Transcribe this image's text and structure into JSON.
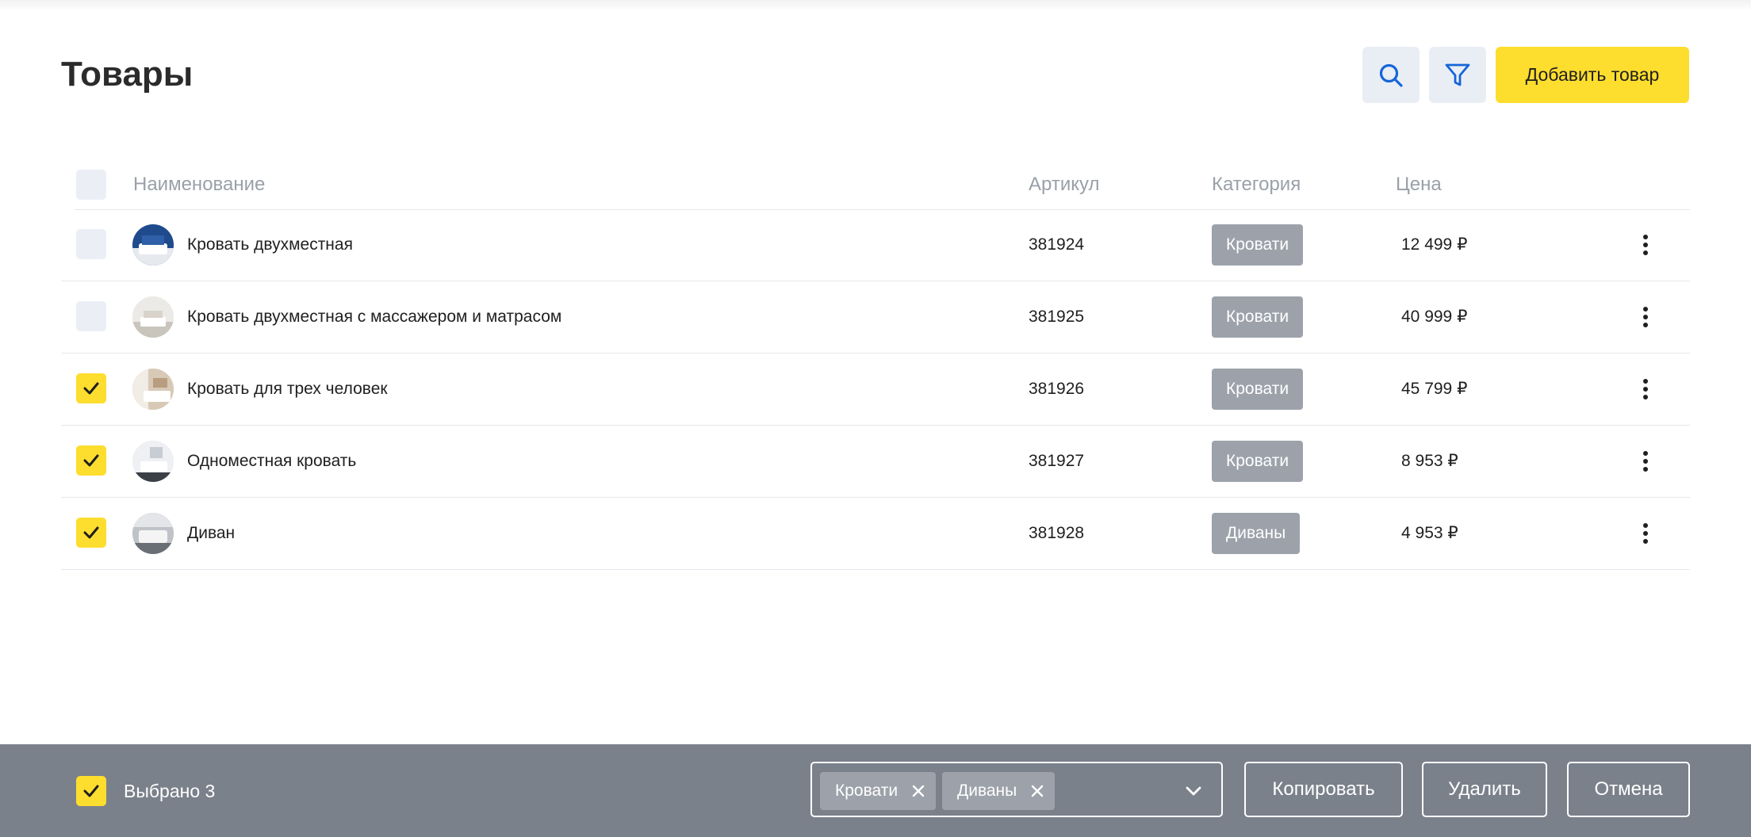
{
  "header": {
    "title": "Товары",
    "search_icon": "search-icon",
    "filter_icon": "filter-icon",
    "add_label": "Добавить товар"
  },
  "colors": {
    "accent": "#FDDD2E",
    "icon_blue": "#1565D8",
    "bar": "#7B818B",
    "badge": "#9DA2AA"
  },
  "table": {
    "columns": [
      "Наименование",
      "Артикул",
      "Категория",
      "Цена"
    ],
    "rows": [
      {
        "name": "Кровать двухместная",
        "sku": "381924",
        "category": "Кровати",
        "price": "12 499 ₽",
        "checked": false
      },
      {
        "name": "Кровать двухместная с массажером и матрасом",
        "sku": "381925",
        "category": "Кровати",
        "price": "40 999 ₽",
        "checked": false
      },
      {
        "name": "Кровать для трех человек",
        "sku": "381926",
        "category": "Кровати",
        "price": "45 799 ₽",
        "checked": true
      },
      {
        "name": "Одноместная кровать",
        "sku": "381927",
        "category": "Кровати",
        "price": "8 953 ₽",
        "checked": true
      },
      {
        "name": "Диван",
        "sku": "381928",
        "category": "Диваны",
        "price": "4 953 ₽",
        "checked": true
      }
    ]
  },
  "bottom_bar": {
    "selected_label": "Выбрано 3",
    "chips": [
      "Кровати",
      "Диваны"
    ],
    "copy_label": "Копировать",
    "delete_label": "Удалить",
    "cancel_label": "Отмена"
  }
}
